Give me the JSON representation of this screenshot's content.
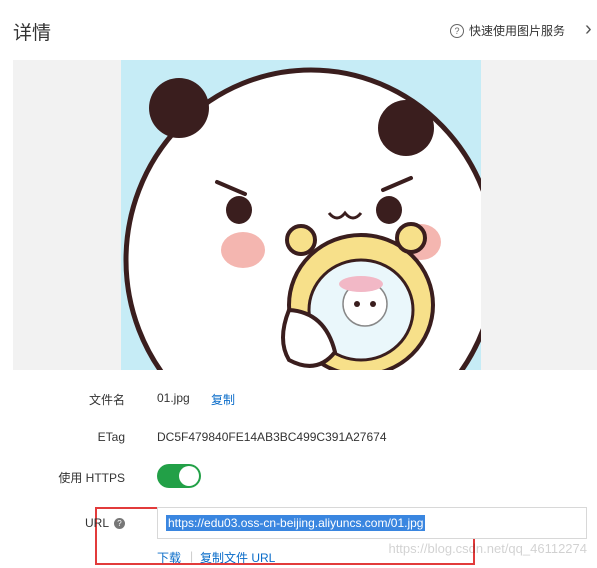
{
  "header": {
    "title": "详情",
    "help_text": "快速使用图片服务",
    "help_icon": "question-circle-icon",
    "next_icon": "chevron-right-icon"
  },
  "details": {
    "filename_label": "文件名",
    "filename_value": "01.jpg",
    "copy_label": "复制",
    "etag_label": "ETag",
    "etag_value": "DC5F479840FE14AB3BC499C391A27674",
    "https_label": "使用 HTTPS",
    "https_enabled": true,
    "url_label": "URL",
    "url_value": "https://edu03.oss-cn-beijing.aliyuncs.com/01.jpg",
    "download_label": "下载",
    "copy_url_label": "复制文件 URL"
  },
  "watermark": "https://blog.csdn.net/qq_46112274",
  "colors": {
    "toggle_on": "#22a047",
    "link": "#0a6cc9",
    "highlight_border": "#e23b3b",
    "preview_bg": "#c6ecf6"
  }
}
